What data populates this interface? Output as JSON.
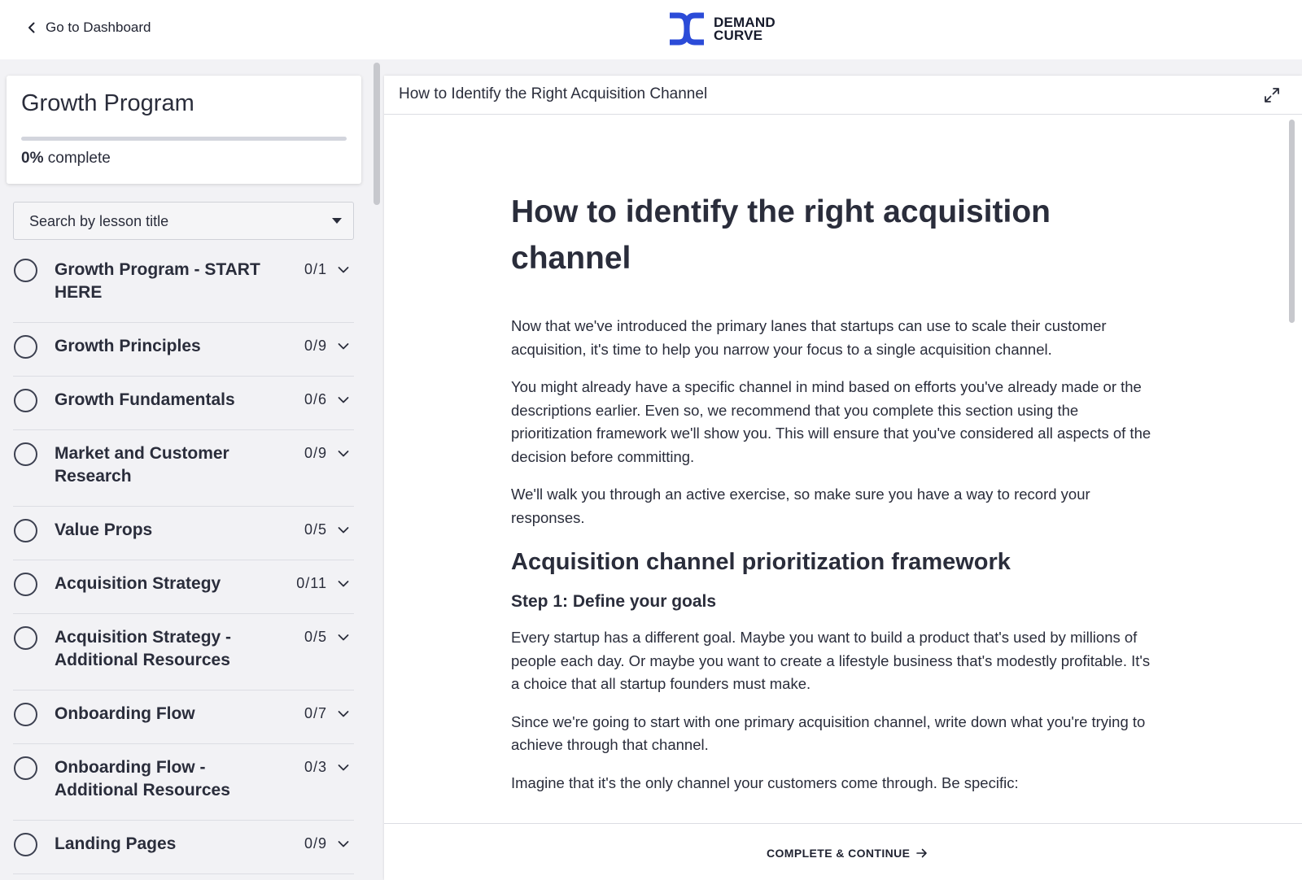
{
  "header": {
    "back_label": "Go to Dashboard",
    "back_icon": "chevron-left-icon",
    "logo": {
      "line1": "DEMAND",
      "line2": "CURVE",
      "brand_color": "#2b4bd8"
    }
  },
  "sidebar": {
    "program_title": "Growth Program",
    "progress": {
      "percent_value": 0,
      "percent_text": "0%",
      "suffix": "complete"
    },
    "search_placeholder": "Search by lesson title",
    "modules": [
      {
        "name": "Growth Program - START HERE",
        "count": "0/1"
      },
      {
        "name": "Growth Principles",
        "count": "0/9"
      },
      {
        "name": "Growth Fundamentals",
        "count": "0/6"
      },
      {
        "name": "Market and Customer Research",
        "count": "0/9"
      },
      {
        "name": "Value Props",
        "count": "0/5"
      },
      {
        "name": "Acquisition Strategy",
        "count": "0/11"
      },
      {
        "name": "Acquisition Strategy - Additional Resources",
        "count": "0/5"
      },
      {
        "name": "Onboarding Flow",
        "count": "0/7"
      },
      {
        "name": "Onboarding Flow - Additional Resources",
        "count": "0/3"
      },
      {
        "name": "Landing Pages",
        "count": "0/9"
      }
    ]
  },
  "lesson": {
    "panel_title": "How to Identify the Right Acquisition Channel",
    "heading": "How to identify the right acquisition channel",
    "paragraphs_intro": [
      "Now that we've introduced the primary lanes that startups can use to scale their customer acquisition, it's time to help you narrow your focus to a single acquisition channel.",
      "You might already have a specific channel in mind based on efforts you've already made or the descriptions earlier. Even so, we recommend that you complete this section using the prioritization framework we'll show you. This will ensure that you've considered all aspects of the decision before committing.",
      "We'll walk you through an active exercise, so make sure you have a way to record your responses."
    ],
    "section_heading": "Acquisition channel prioritization framework",
    "step_heading": "Step 1: Define your goals",
    "paragraphs_step": [
      "Every startup has a different goal. Maybe you want to build a product that's used by millions of people each day. Or maybe you want to create a lifestyle business that's modestly profitable. It's a choice that all startup founders must make.",
      "Since we're going to start with one primary acquisition channel, write down what you're trying to achieve through that channel.",
      "Imagine that it's the only channel your customers come through. Be specific:"
    ],
    "cta_label": "COMPLETE & CONTINUE"
  }
}
